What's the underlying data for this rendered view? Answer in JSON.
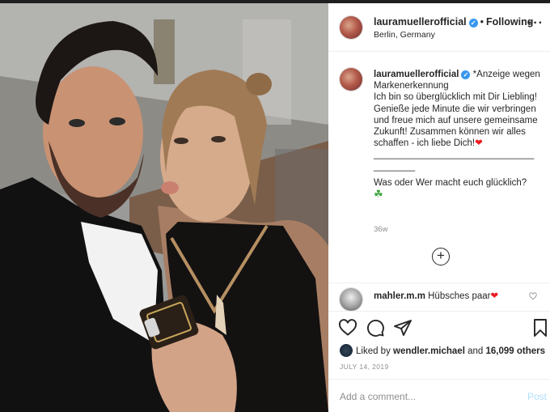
{
  "header": {
    "username": "lauramuellerofficial",
    "verified_mark": "✓",
    "separator": "•",
    "follow_status": "Following",
    "location": "Berlin, Germany",
    "more_label": "···"
  },
  "caption": {
    "username": "lauramuellerofficial",
    "verified_mark": "✓",
    "line1": "*Anzeige wegen Markenerkennung",
    "line2": "Ich bin so überglücklich mit Dir Liebling! Genieße jede Minute die wir verbringen und freue mich auf unsere gemeinsame Zukunft! Zusammen können wir alles schaffen - ich liebe Dich!",
    "heart": "❤",
    "divider": "_______________________________",
    "divider2": "________",
    "question": "Was oder Wer macht euch glücklich?",
    "clover": "☘",
    "time_ago": "36w",
    "load_more": "+"
  },
  "comments": [
    {
      "username": "mahler.m.m",
      "text": "Hübsches paar",
      "heart": "❤"
    }
  ],
  "actions": {
    "icons": [
      "heart-outline-icon",
      "comment-icon",
      "share-icon",
      "bookmark-icon"
    ]
  },
  "likes": {
    "prefix": "Liked by",
    "user": "wendler.michael",
    "middle": "and",
    "count": "16,099 others"
  },
  "post_date": "JULY 14, 2019",
  "add_comment": {
    "placeholder": "Add a comment...",
    "post_label": "Post"
  },
  "colors": {
    "accent": "#3897f0",
    "heart": "#ed1c24",
    "post_disabled": "#b2dffc",
    "muted": "#8e8e8e"
  }
}
